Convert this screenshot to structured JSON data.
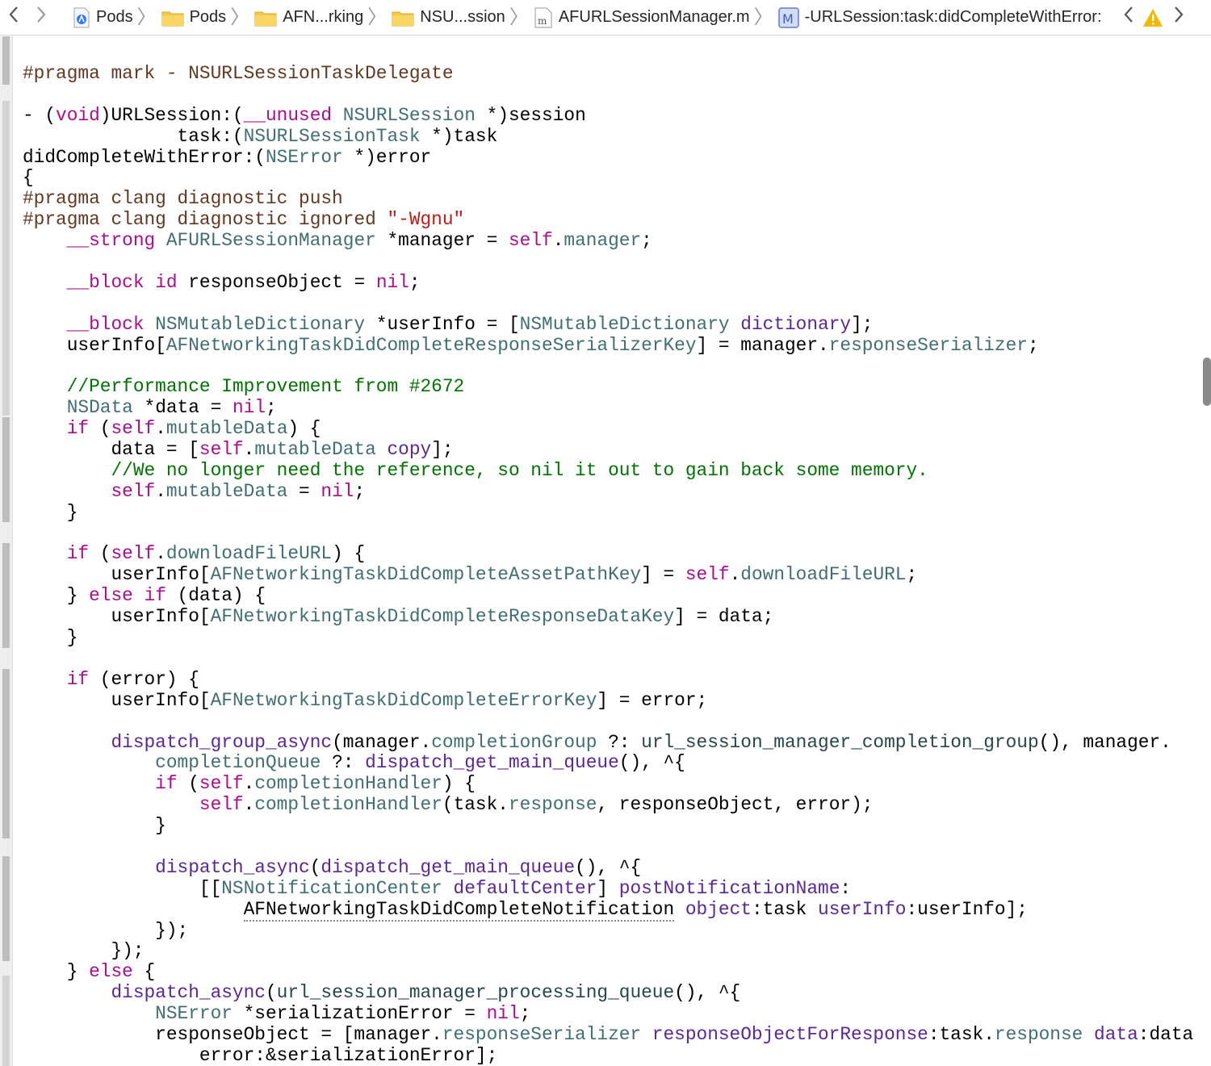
{
  "jumpbar": {
    "back_icon": "chevron-left",
    "forward_icon": "chevron-right",
    "crumbs": [
      {
        "label": "Pods",
        "icon": "xcode-project-icon"
      },
      {
        "label": "Pods",
        "icon": "folder-icon"
      },
      {
        "label": "AFN...rking",
        "icon": "folder-icon"
      },
      {
        "label": "NSU...ssion",
        "icon": "folder-icon"
      },
      {
        "label": "AFURLSessionManager.m",
        "icon": "objc-source-file-icon"
      },
      {
        "label": "-URLSession:task:didCompleteWithError:",
        "icon": "method-icon"
      }
    ],
    "warning_icon": "warning-triangle",
    "colors": {
      "folder": "#f4c94a",
      "method_badge": "#5b7fd6",
      "warning": "#f5b800"
    }
  },
  "code": {
    "lines": [
      [
        [
          "#pragma mark - NSURLSessionTaskDelegate",
          "pr"
        ]
      ],
      [],
      [
        [
          "- (",
          ""
        ],
        [
          "void",
          "kw"
        ],
        [
          ")URLSession:(",
          ""
        ],
        [
          "__unused",
          "kw"
        ],
        [
          " ",
          ""
        ],
        [
          "NSURLSession",
          "ty"
        ],
        [
          " *)session",
          ""
        ]
      ],
      [
        [
          "              task:(",
          ""
        ],
        [
          "NSURLSessionTask",
          "ty"
        ],
        [
          " *)task",
          ""
        ]
      ],
      [
        [
          "didCompleteWithError:(",
          ""
        ],
        [
          "NSError",
          "ty"
        ],
        [
          " *)error",
          ""
        ]
      ],
      [
        [
          "{",
          ""
        ]
      ],
      [
        [
          "#pragma clang diagnostic push",
          "pr"
        ]
      ],
      [
        [
          "#pragma clang diagnostic ignored ",
          "pr"
        ],
        [
          "\"-Wgnu\"",
          "st"
        ]
      ],
      [
        [
          "    ",
          ""
        ],
        [
          "__strong",
          "kw"
        ],
        [
          " ",
          ""
        ],
        [
          "AFURLSessionManager",
          "ty"
        ],
        [
          " *manager = ",
          ""
        ],
        [
          "self",
          "kw"
        ],
        [
          ".",
          ""
        ],
        [
          "manager",
          "cn"
        ],
        [
          ";",
          ""
        ]
      ],
      [],
      [
        [
          "    ",
          ""
        ],
        [
          "__block",
          "kw"
        ],
        [
          " ",
          ""
        ],
        [
          "id",
          "kw"
        ],
        [
          " responseObject = ",
          ""
        ],
        [
          "nil",
          "kw"
        ],
        [
          ";",
          ""
        ]
      ],
      [],
      [
        [
          "    ",
          ""
        ],
        [
          "__block",
          "kw"
        ],
        [
          " ",
          ""
        ],
        [
          "NSMutableDictionary",
          "ty"
        ],
        [
          " *userInfo = [",
          ""
        ],
        [
          "NSMutableDictionary",
          "ty"
        ],
        [
          " ",
          ""
        ],
        [
          "dictionary",
          "mt"
        ],
        [
          "];",
          ""
        ]
      ],
      [
        [
          "    userInfo[",
          ""
        ],
        [
          "AFNetworkingTaskDidCompleteResponseSerializerKey",
          "cn"
        ],
        [
          "] = manager.",
          ""
        ],
        [
          "responseSerializer",
          "cn"
        ],
        [
          ";",
          ""
        ]
      ],
      [],
      [
        [
          "    ",
          ""
        ],
        [
          "//Performance Improvement from #2672",
          "cm"
        ]
      ],
      [
        [
          "    ",
          ""
        ],
        [
          "NSData",
          "ty"
        ],
        [
          " *data = ",
          ""
        ],
        [
          "nil",
          "kw"
        ],
        [
          ";",
          ""
        ]
      ],
      [
        [
          "    ",
          ""
        ],
        [
          "if",
          "kw"
        ],
        [
          " (",
          ""
        ],
        [
          "self",
          "kw"
        ],
        [
          ".",
          ""
        ],
        [
          "mutableData",
          "cn"
        ],
        [
          ") {",
          ""
        ]
      ],
      [
        [
          "        data = [",
          ""
        ],
        [
          "self",
          "kw"
        ],
        [
          ".",
          ""
        ],
        [
          "mutableData",
          "cn"
        ],
        [
          " ",
          ""
        ],
        [
          "copy",
          "mt"
        ],
        [
          "];",
          ""
        ]
      ],
      [
        [
          "        ",
          ""
        ],
        [
          "//We no longer need the reference, so nil it out to gain back some memory.",
          "cm"
        ]
      ],
      [
        [
          "        ",
          ""
        ],
        [
          "self",
          "kw"
        ],
        [
          ".",
          ""
        ],
        [
          "mutableData",
          "cn"
        ],
        [
          " = ",
          ""
        ],
        [
          "nil",
          "kw"
        ],
        [
          ";",
          ""
        ]
      ],
      [
        [
          "    }",
          ""
        ]
      ],
      [],
      [
        [
          "    ",
          ""
        ],
        [
          "if",
          "kw"
        ],
        [
          " (",
          ""
        ],
        [
          "self",
          "kw"
        ],
        [
          ".",
          ""
        ],
        [
          "downloadFileURL",
          "cn"
        ],
        [
          ") {",
          ""
        ]
      ],
      [
        [
          "        userInfo[",
          ""
        ],
        [
          "AFNetworkingTaskDidCompleteAssetPathKey",
          "cn"
        ],
        [
          "] = ",
          ""
        ],
        [
          "self",
          "kw"
        ],
        [
          ".",
          ""
        ],
        [
          "downloadFileURL",
          "cn"
        ],
        [
          ";",
          ""
        ]
      ],
      [
        [
          "    } ",
          ""
        ],
        [
          "else",
          "kw"
        ],
        [
          " ",
          ""
        ],
        [
          "if",
          "kw"
        ],
        [
          " (data) {",
          ""
        ]
      ],
      [
        [
          "        userInfo[",
          ""
        ],
        [
          "AFNetworkingTaskDidCompleteResponseDataKey",
          "cn"
        ],
        [
          "] = data;",
          ""
        ]
      ],
      [
        [
          "    }",
          ""
        ]
      ],
      [],
      [
        [
          "    ",
          ""
        ],
        [
          "if",
          "kw"
        ],
        [
          " (error) {",
          ""
        ]
      ],
      [
        [
          "        userInfo[",
          ""
        ],
        [
          "AFNetworkingTaskDidCompleteErrorKey",
          "cn"
        ],
        [
          "] = error;",
          ""
        ]
      ],
      [],
      [
        [
          "        ",
          ""
        ],
        [
          "dispatch_group_async",
          "mt"
        ],
        [
          "(manager.",
          ""
        ],
        [
          "completionGroup",
          "cn"
        ],
        [
          " ?: ",
          ""
        ],
        [
          "url_session_manager_completion_group",
          "fn"
        ],
        [
          "(), manager.",
          ""
        ]
      ],
      [
        [
          "            ",
          ""
        ],
        [
          "completionQueue",
          "cn"
        ],
        [
          " ?: ",
          ""
        ],
        [
          "dispatch_get_main_queue",
          "mt"
        ],
        [
          "(), ^{",
          ""
        ]
      ],
      [
        [
          "            ",
          ""
        ],
        [
          "if",
          "kw"
        ],
        [
          " (",
          ""
        ],
        [
          "self",
          "kw"
        ],
        [
          ".",
          ""
        ],
        [
          "completionHandler",
          "cn"
        ],
        [
          ") {",
          ""
        ]
      ],
      [
        [
          "                ",
          ""
        ],
        [
          "self",
          "kw"
        ],
        [
          ".",
          ""
        ],
        [
          "completionHandler",
          "cn"
        ],
        [
          "(task.",
          ""
        ],
        [
          "response",
          "cn"
        ],
        [
          ", responseObject, error);",
          ""
        ]
      ],
      [
        [
          "            }",
          ""
        ]
      ],
      [],
      [
        [
          "            ",
          ""
        ],
        [
          "dispatch_async",
          "mt"
        ],
        [
          "(",
          ""
        ],
        [
          "dispatch_get_main_queue",
          "mt"
        ],
        [
          "(), ^{",
          ""
        ]
      ],
      [
        [
          "                [[",
          ""
        ],
        [
          "NSNotificationCenter",
          "ty"
        ],
        [
          " ",
          ""
        ],
        [
          "defaultCenter",
          "mt"
        ],
        [
          "] ",
          ""
        ],
        [
          "postNotificationName",
          "mt"
        ],
        [
          ":",
          ""
        ]
      ],
      [
        [
          "                    ",
          ""
        ],
        [
          "AFNetworkingTaskDidCompleteNotification",
          "hl"
        ],
        [
          " ",
          ""
        ],
        [
          "object",
          "mt"
        ],
        [
          ":task ",
          ""
        ],
        [
          "userInfo",
          "mt"
        ],
        [
          ":userInfo];",
          ""
        ]
      ],
      [
        [
          "            });",
          ""
        ]
      ],
      [
        [
          "        });",
          ""
        ]
      ],
      [
        [
          "    } ",
          ""
        ],
        [
          "else",
          "kw"
        ],
        [
          " {",
          ""
        ]
      ],
      [
        [
          "        ",
          ""
        ],
        [
          "dispatch_async",
          "mt"
        ],
        [
          "(",
          ""
        ],
        [
          "url_session_manager_processing_queue",
          "fn"
        ],
        [
          "(), ^{",
          ""
        ]
      ],
      [
        [
          "            ",
          ""
        ],
        [
          "NSError",
          "ty"
        ],
        [
          " *serializationError = ",
          ""
        ],
        [
          "nil",
          "kw"
        ],
        [
          ";",
          ""
        ]
      ],
      [
        [
          "            responseObject = [manager.",
          ""
        ],
        [
          "responseSerializer",
          "cn"
        ],
        [
          " ",
          ""
        ],
        [
          "responseObjectForResponse",
          "mt"
        ],
        [
          ":task.",
          ""
        ],
        [
          "response",
          "cn"
        ],
        [
          " ",
          ""
        ],
        [
          "data",
          "mt"
        ],
        [
          ":data",
          ""
        ]
      ],
      [
        [
          "                error:&serializationError];",
          ""
        ]
      ]
    ]
  }
}
